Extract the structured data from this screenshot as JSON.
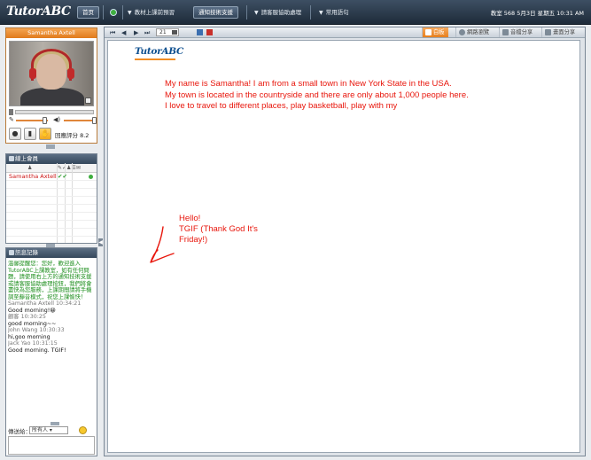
{
  "app": {
    "logo": "TutorABC",
    "home_button": "首页",
    "menu": [
      "教材上課前預習",
      "通知技術支援",
      "請客服協助處理",
      "常用語句"
    ],
    "status": "教室 568 5月3日 星期五 10:31 AM"
  },
  "video": {
    "presenter_name": "Samantha Axtell",
    "rating_label": "回應評分 8.2"
  },
  "roster": {
    "title": "線上會員",
    "users": [
      {
        "name": "Samantha Axtell",
        "checks": "✔✔"
      }
    ]
  },
  "chat": {
    "title": "訊息記錄",
    "messages": [
      {
        "type": "sys",
        "text": "溫馨提醒您：您好，歡迎進入TutorABC上課教室，如有任何問題，請使用右上方的通知技術支援或請客服協助處理按鈕，我們將會盡快為您服務，上課期間請將手機調至靜音模式，祝您上課愉快！"
      },
      {
        "type": "meta",
        "text": "Samantha Axtell 10:34:21"
      },
      {
        "type": "msg",
        "text": "Good morning!😀"
      },
      {
        "type": "meta",
        "text": "顧客 10:30:25"
      },
      {
        "type": "msg",
        "text": "good morning~~"
      },
      {
        "type": "meta",
        "text": "John Wang 10:30:33"
      },
      {
        "type": "msg",
        "text": "hi,goo morning"
      },
      {
        "type": "meta",
        "text": "Jack Yao 10:31:15"
      },
      {
        "type": "msg",
        "text": "Good morning. TGIF!"
      }
    ],
    "to_label": "傳送給：",
    "to_value": "所有人"
  },
  "main": {
    "page_number": "21",
    "tabs": [
      "白板",
      "網路瀏覽",
      "音檔分享",
      "畫面分享"
    ],
    "slide": {
      "logo": "TutorABC",
      "lines": [
        "My name is Samantha! I am from a small town in New York State in the USA.",
        "My town is located in the countryside and there are only about 1,000 people here.",
        "I love to travel to different places, play basketball, play with my"
      ],
      "annotation": [
        "Hello!",
        "TGIF (Thank God It's",
        "Friday!)"
      ]
    }
  }
}
